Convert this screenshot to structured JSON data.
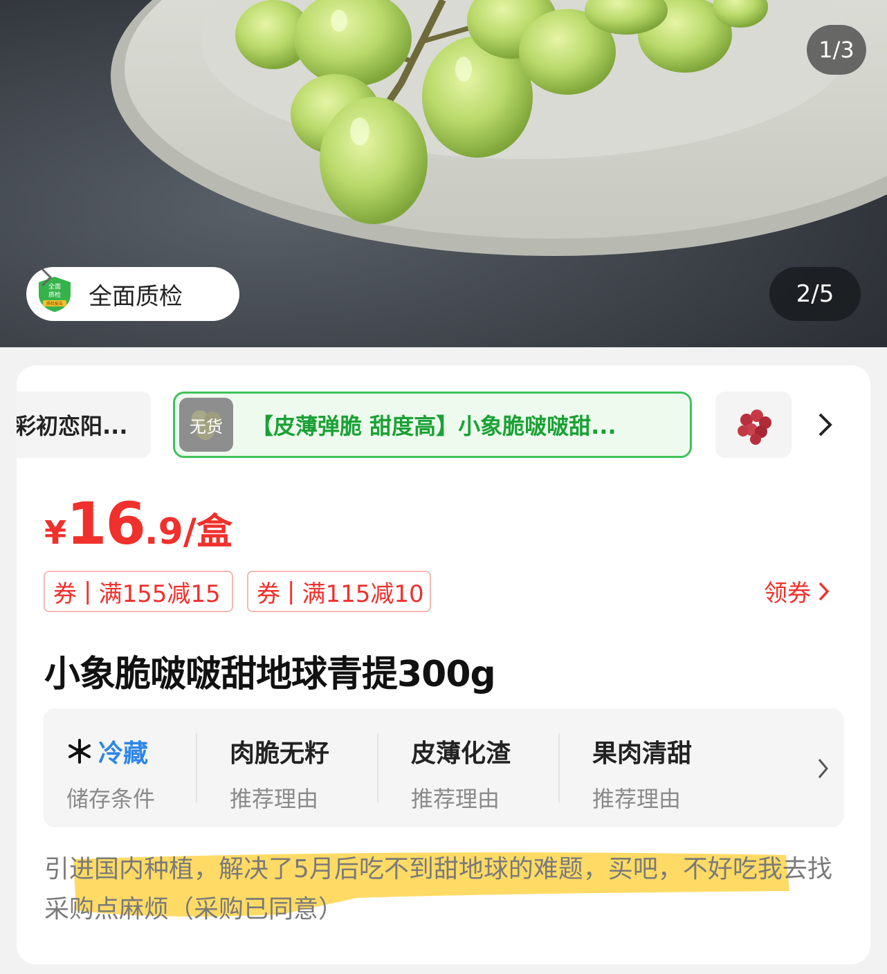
{
  "gallery": {
    "image_counter": "1/3",
    "page_counter": "2/5",
    "quality_label": "全面质检",
    "quality_badge_text": [
      "全面",
      "质检",
      "质检报告"
    ]
  },
  "variants": {
    "left_label": "彩初恋阳...",
    "selected": {
      "stock_label": "无货",
      "title": "【皮薄弹脆 甜度高】小象脆啵啵甜..."
    }
  },
  "price": {
    "currency": "¥",
    "integer": "16",
    "decimal": ".9",
    "unit": "/盒"
  },
  "coupons": [
    {
      "tag": "券",
      "text": "满155减15"
    },
    {
      "tag": "券",
      "text": "满115减10"
    }
  ],
  "get_coupon_label": "领券",
  "product_title": "小象脆啵啵甜地球青提300g",
  "features": [
    {
      "main": "冷藏",
      "sub": "储存条件",
      "icon": "snowflake-icon"
    },
    {
      "main": "肉脆无籽",
      "sub": "推荐理由"
    },
    {
      "main": "皮薄化渣",
      "sub": "推荐理由"
    },
    {
      "main": "果肉清甜",
      "sub": "推荐理由"
    }
  ],
  "description": "引进国内种植，解决了5月后吃不到甜地球的难题，买吧，不好吃我去找采购点麻烦（采购已同意）",
  "colors": {
    "price_red": "#f0302c",
    "selected_green": "#1aa135",
    "cold_blue": "#2f86e8",
    "highlight_yellow": "#ffd54a"
  }
}
